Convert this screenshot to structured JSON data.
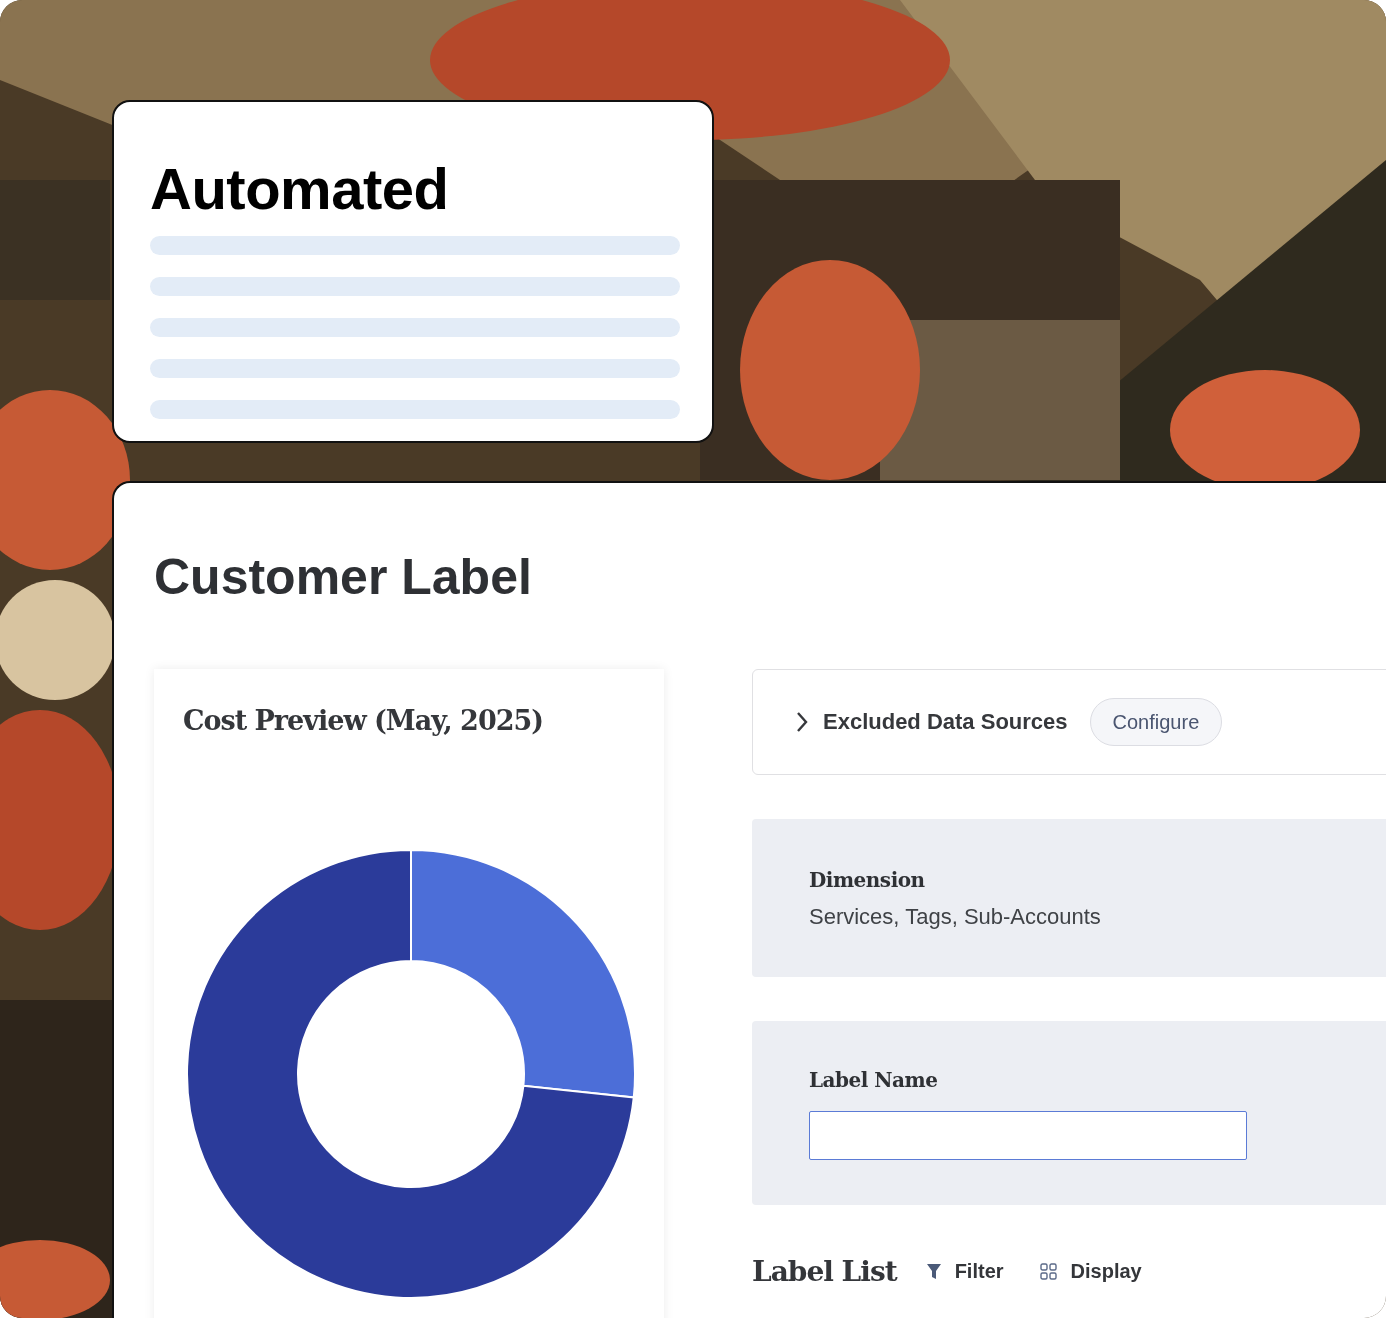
{
  "automated_card": {
    "title": "Automated"
  },
  "panel": {
    "title": "Customer Label"
  },
  "cost_preview": {
    "title": "Cost Preview (May, 2025)"
  },
  "excluded_sources": {
    "label": "Excluded Data Sources",
    "expanded": false,
    "button": "Configure"
  },
  "dimension": {
    "label": "Dimension",
    "value": "Services, Tags, Sub-Accounts"
  },
  "label_name": {
    "label": "Label Name"
  },
  "label_list": {
    "title": "Label List",
    "actions": [
      {
        "kind": "filter",
        "label": "Filter"
      },
      {
        "kind": "display",
        "label": "Display"
      }
    ]
  }
}
